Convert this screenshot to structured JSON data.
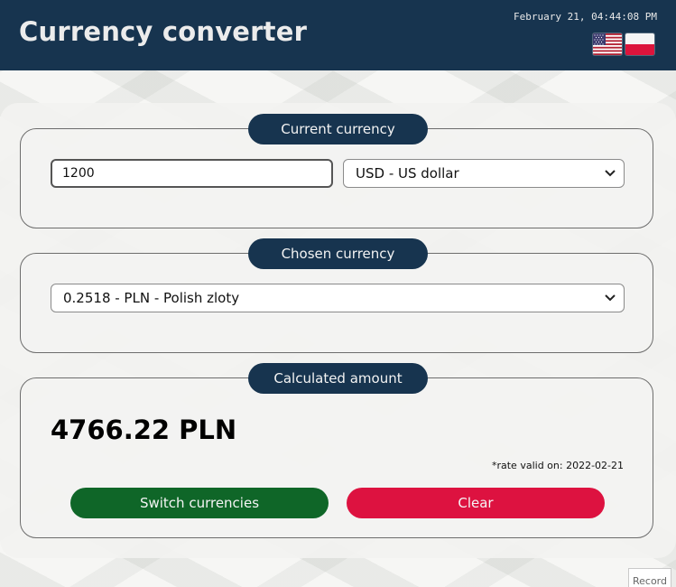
{
  "app": {
    "title": "Currency converter",
    "datetime": "February 21, 04:44:08 PM"
  },
  "flags": [
    {
      "name": "us-flag-icon",
      "lang": "en"
    },
    {
      "name": "pl-flag-icon",
      "lang": "pl"
    }
  ],
  "current": {
    "legend": "Current currency",
    "amount_value": "1200",
    "currency_selected": "USD - US dollar"
  },
  "chosen": {
    "legend": "Chosen currency",
    "currency_selected": "0.2518 - PLN - Polish zloty"
  },
  "calculated": {
    "legend": "Calculated amount",
    "result": "4766.22 PLN",
    "rate_note": "*rate valid on: 2022-02-21",
    "switch_label": "Switch currencies",
    "clear_label": "Clear"
  },
  "record": {
    "label": "Record"
  },
  "colors": {
    "header_bg": "#17344f",
    "legend_bg": "#17344f",
    "switch_bg": "#0f6628",
    "clear_bg": "#dd1240"
  }
}
